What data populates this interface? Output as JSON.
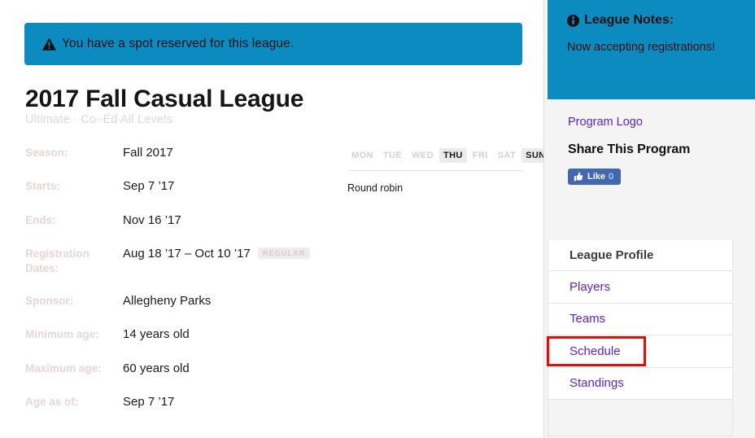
{
  "alert": {
    "icon": "warning-triangle-icon",
    "message": "You have a spot reserved for this league."
  },
  "header": {
    "title": "2017 Fall Casual League",
    "subtitle": "Ultimate · Co–Ed All Levels"
  },
  "details": [
    {
      "label": "Season:",
      "value": "Fall 2017",
      "badge": null
    },
    {
      "label": "Starts:",
      "value": "Sep 7 ’17",
      "badge": null
    },
    {
      "label": "Ends:",
      "value": "Nov 16 ’17",
      "badge": null
    },
    {
      "label": "Registration Dates:",
      "value": "Aug 18 ’17 – Oct 10 ’17",
      "badge": "REGULAR"
    },
    {
      "label": "Sponsor:",
      "value": "Allegheny Parks",
      "badge": null
    },
    {
      "label": "Minimum age:",
      "value": "14 years old",
      "badge": null
    },
    {
      "label": "Maximum age:",
      "value": "60 years old",
      "badge": null
    },
    {
      "label": "Age as of:",
      "value": "Sep 7 ’17",
      "badge": null
    }
  ],
  "schedule_widget": {
    "days": [
      {
        "label": "MON",
        "active": false
      },
      {
        "label": "TUE",
        "active": false
      },
      {
        "label": "WED",
        "active": false
      },
      {
        "label": "THU",
        "active": true
      },
      {
        "label": "FRI",
        "active": false
      },
      {
        "label": "SAT",
        "active": false
      },
      {
        "label": "SUN",
        "active": true
      }
    ],
    "format": "Round robin"
  },
  "sidebar": {
    "notes": {
      "icon": "info-circle-icon",
      "title": "League Notes:",
      "body": "Now accepting registrations!"
    },
    "share": {
      "program_logo_link": "Program Logo",
      "title": "Share This Program",
      "facebook": {
        "icon": "thumbs-up-icon",
        "label": "Like",
        "count": "0"
      }
    },
    "nav": {
      "header": "League Profile",
      "items": [
        {
          "label": "Players"
        },
        {
          "label": "Teams"
        },
        {
          "label": "Schedule"
        },
        {
          "label": "Standings"
        }
      ]
    }
  },
  "annotation": {
    "target": "Schedule",
    "color": "#fe0000"
  },
  "colors": {
    "accent_blue": "#0c8bc0",
    "link_purple": "#5b20d6",
    "facebook_blue": "#4267b2",
    "muted_label": "#e6d6d6",
    "panel_grey": "#f4f4f4"
  }
}
